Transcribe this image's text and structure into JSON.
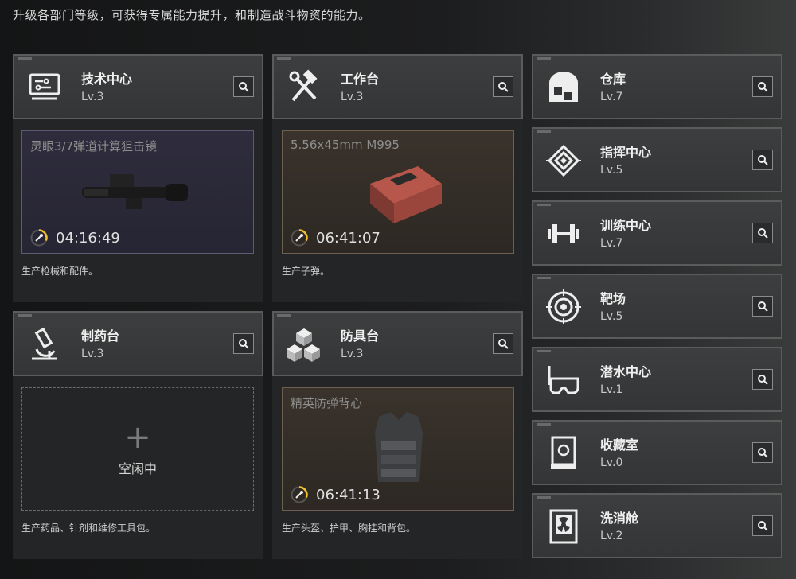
{
  "header": {
    "subtitle": "升级各部门等级，可获得专属能力提升，和制造战斗物资的能力。"
  },
  "left_facilities": [
    {
      "name": "技术中心",
      "level": "Lv.3",
      "icon": "monitor-icon"
    },
    {
      "name": "工作台",
      "level": "Lv.3",
      "icon": "hammer-wrench-icon"
    },
    {
      "name": "制药台",
      "level": "Lv.3",
      "icon": "microscope-icon"
    },
    {
      "name": "防具台",
      "level": "Lv.3",
      "icon": "cubes-icon"
    }
  ],
  "productions": [
    {
      "item": "灵眼3/7弹道计算狙击镜",
      "timer": "04:16:49",
      "progress": 0.3,
      "desc": "生产枪械和配件。"
    },
    {
      "item": "5.56x45mm M995",
      "timer": "06:41:07",
      "progress": 0.3,
      "desc": "生产子弹。"
    },
    {
      "idle_label": "空闲中",
      "desc": "生产药品、针剂和维修工具包。"
    },
    {
      "item": "精英防弹背心",
      "timer": "06:41:13",
      "progress": 0.3,
      "desc": "生产头盔、护甲、胸挂和背包。"
    }
  ],
  "right_facilities": [
    {
      "name": "仓库",
      "level": "Lv.7",
      "icon": "warehouse-icon"
    },
    {
      "name": "指挥中心",
      "level": "Lv.5",
      "icon": "command-chip-icon"
    },
    {
      "name": "训练中心",
      "level": "Lv.7",
      "icon": "dumbbell-icon"
    },
    {
      "name": "靶场",
      "level": "Lv.5",
      "icon": "target-icon"
    },
    {
      "name": "潜水中心",
      "level": "Lv.1",
      "icon": "diving-mask-icon"
    },
    {
      "name": "收藏室",
      "level": "Lv.0",
      "icon": "display-case-icon"
    },
    {
      "name": "洗消舱",
      "level": "Lv.2",
      "icon": "radiation-chamber-icon"
    }
  ],
  "colors": {
    "accent_progress": "#f2c230",
    "panel": "#242526",
    "header": "#3a3b3c"
  }
}
